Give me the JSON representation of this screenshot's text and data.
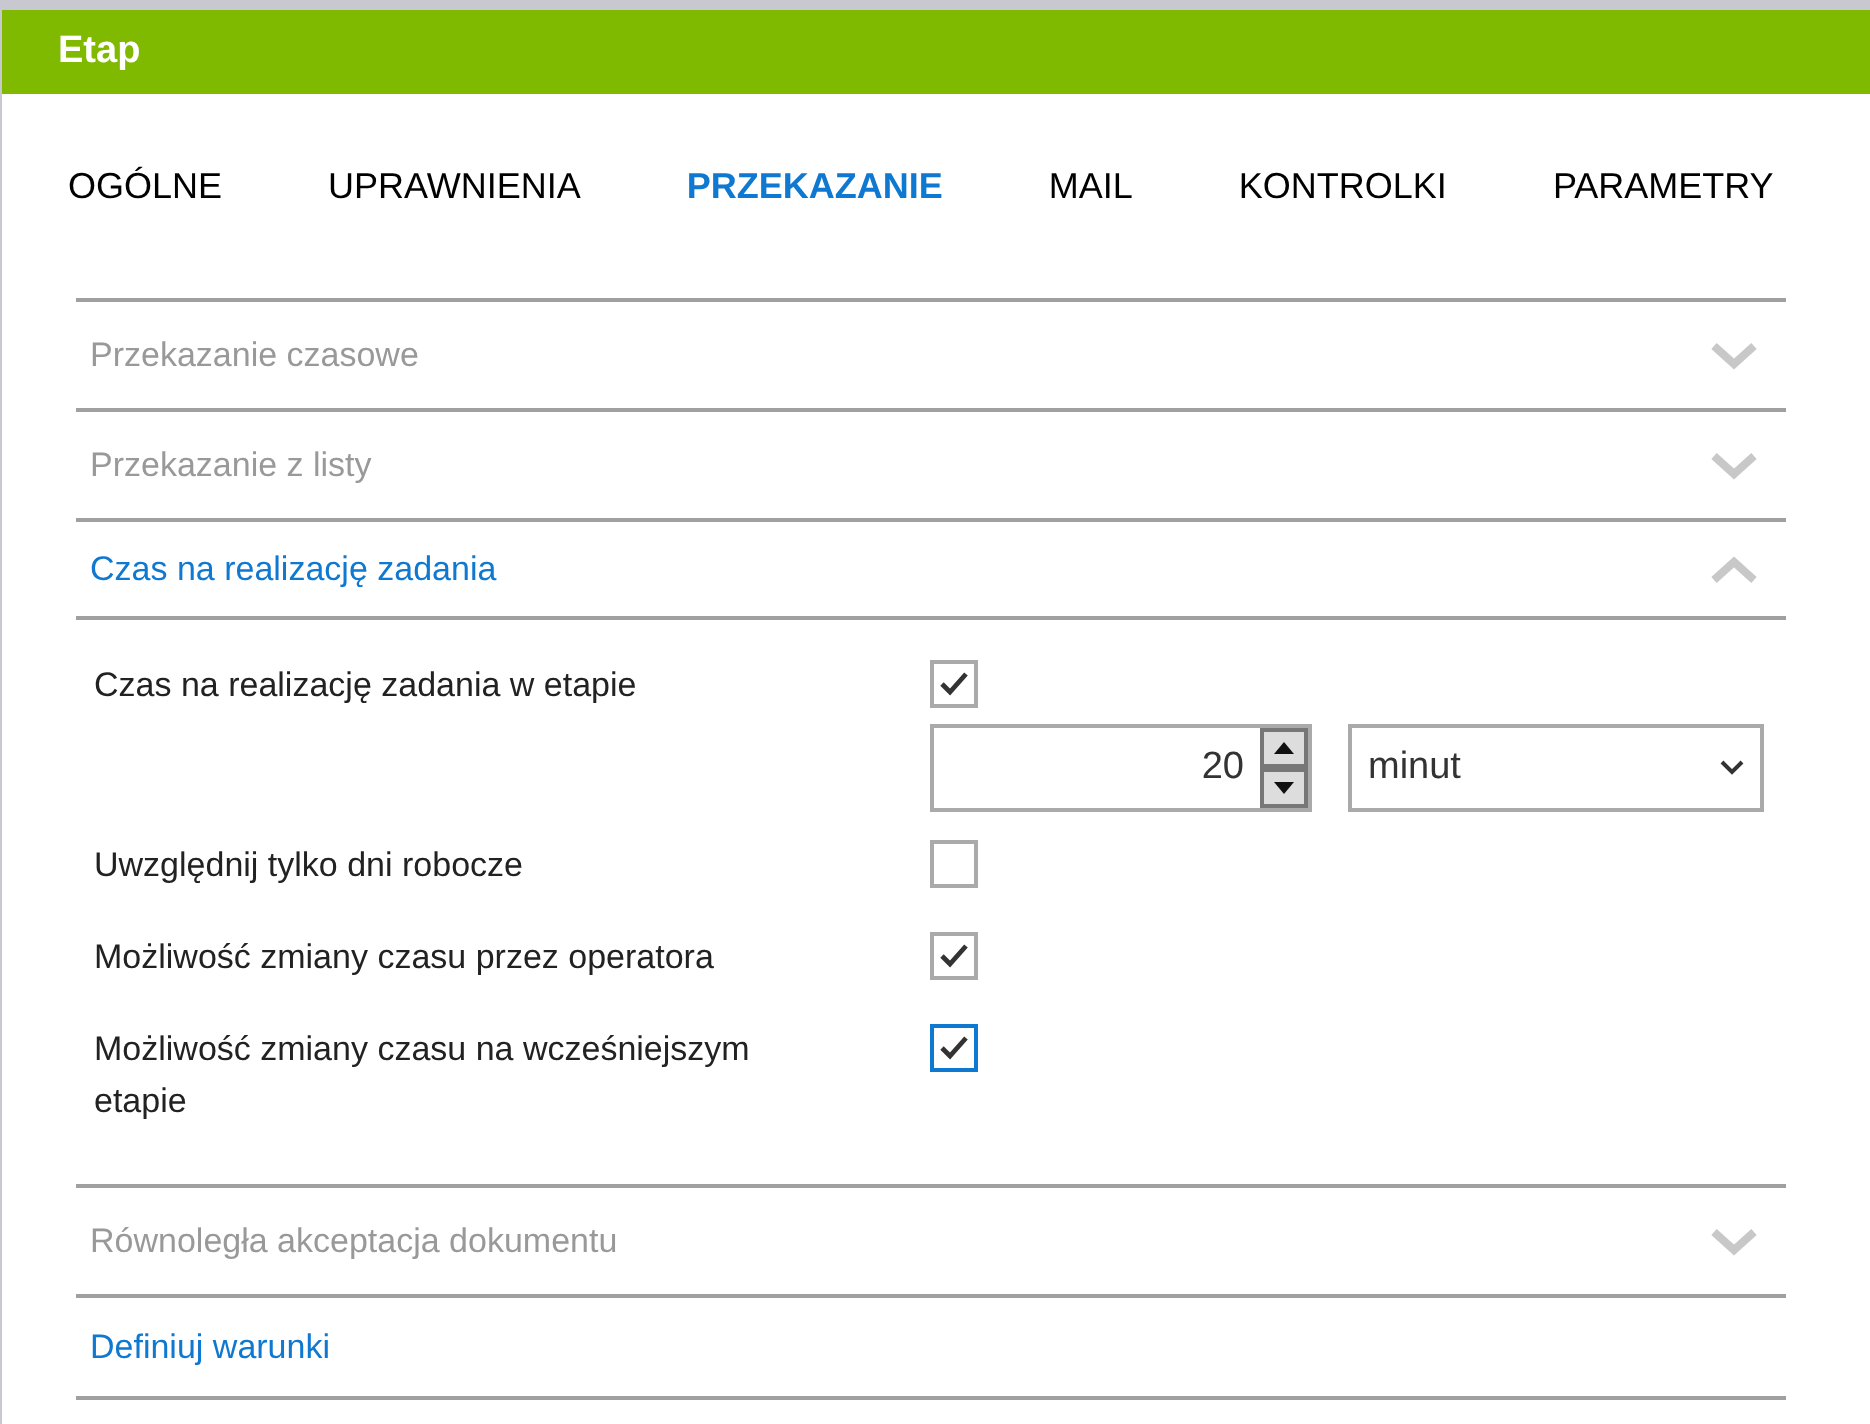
{
  "window": {
    "title": "Etap"
  },
  "tabs": [
    {
      "label": "OGÓLNE",
      "selected": false
    },
    {
      "label": "UPRAWNIENIA",
      "selected": false
    },
    {
      "label": "PRZEKAZANIE",
      "selected": true
    },
    {
      "label": "MAIL",
      "selected": false
    },
    {
      "label": "KONTROLKI",
      "selected": false
    },
    {
      "label": "PARAMETRY",
      "selected": false
    }
  ],
  "sections": [
    {
      "kind": "accordion",
      "title": "Przekazanie czasowe",
      "expanded": false
    },
    {
      "kind": "accordion",
      "title": "Przekazanie z listy",
      "expanded": false
    },
    {
      "kind": "accordion",
      "title": "Czas na realizację zadania",
      "expanded": true,
      "fields": [
        {
          "kind": "checkbox",
          "label": "Czas na realizację zadania w etapie",
          "checked": true,
          "focused": false
        },
        {
          "kind": "duration",
          "value": "20",
          "unit": "minut"
        },
        {
          "kind": "checkbox",
          "label": "Uwzględnij tylko dni robocze",
          "checked": false,
          "focused": false
        },
        {
          "kind": "checkbox",
          "label": "Możliwość zmiany czasu przez operatora",
          "checked": true,
          "focused": false
        },
        {
          "kind": "checkbox",
          "label": "Możliwość zmiany czasu na wcześniejszym etapie",
          "checked": true,
          "focused": true
        }
      ]
    },
    {
      "kind": "accordion",
      "title": "Równoległa akceptacja dokumentu",
      "expanded": false
    },
    {
      "kind": "link",
      "title": "Definiuj warunki"
    }
  ]
}
